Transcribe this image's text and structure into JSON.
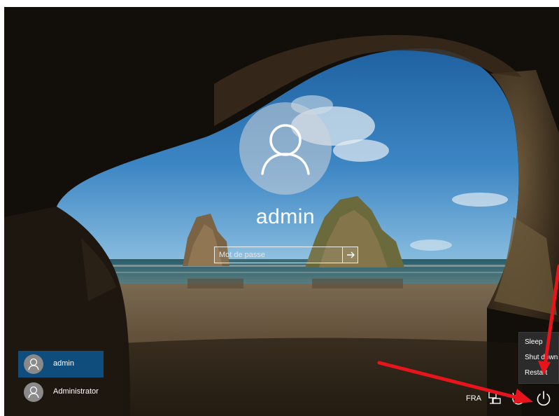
{
  "login": {
    "username": "admin",
    "password_placeholder": "Mot de passe"
  },
  "users": [
    {
      "name": "admin",
      "selected": true
    },
    {
      "name": "Administrator",
      "selected": false
    }
  ],
  "tray": {
    "language": "FRA"
  },
  "power_menu": {
    "items": [
      "Sleep",
      "Shut down",
      "Restart"
    ]
  },
  "icons": {
    "avatar": "user-silhouette-icon",
    "submit": "arrow-right-icon",
    "network": "network-icon",
    "ease_of_access": "ease-of-access-icon",
    "power": "power-icon"
  },
  "colors": {
    "selected_user": "#0f4d7c",
    "annotation_arrow": "#e8141b"
  }
}
